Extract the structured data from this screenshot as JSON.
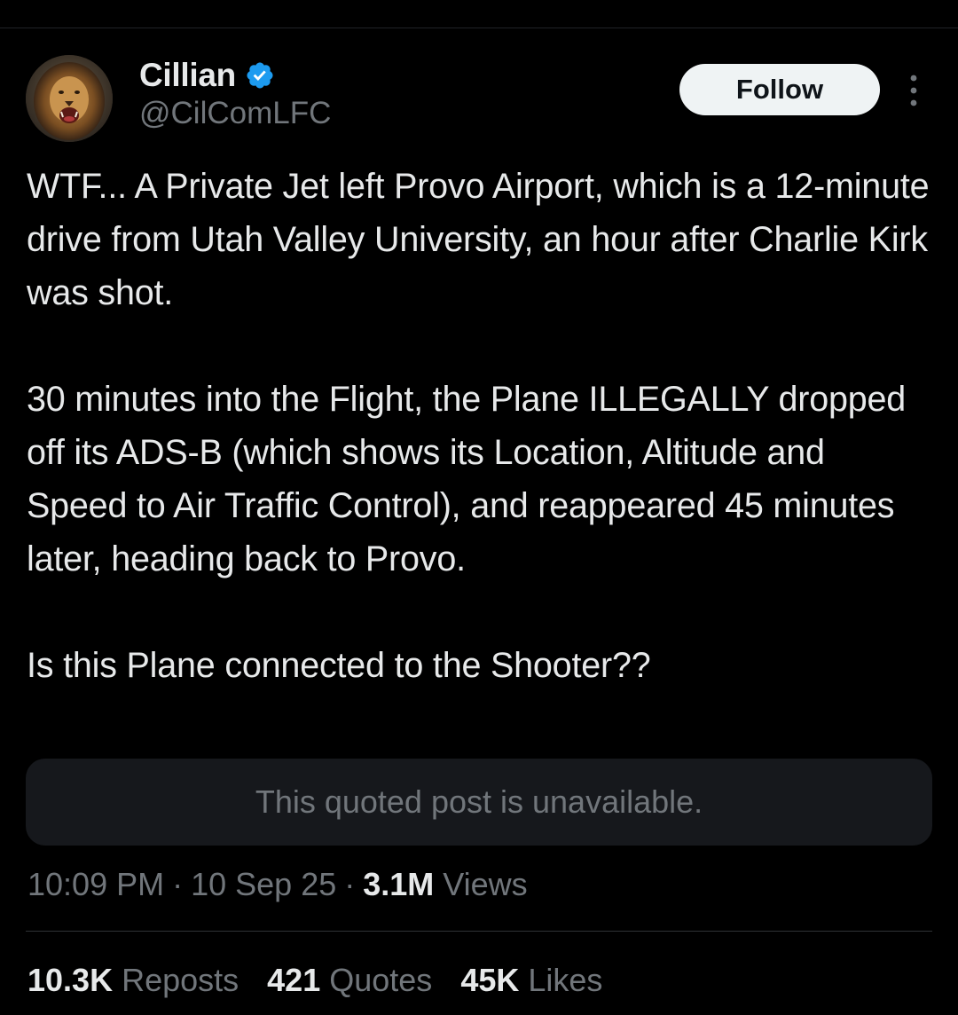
{
  "author": {
    "display_name": "Cillian",
    "handle": "@CilComLFC",
    "verified_icon": "verified-badge-icon",
    "avatar_icon": "lion-avatar"
  },
  "header": {
    "follow_label": "Follow",
    "more_icon": "more-vertical-icon"
  },
  "post": {
    "paragraphs": [
      "WTF... A Private Jet left Provo Airport, which is a 12-minute drive from Utah Valley University, an hour after Charlie Kirk was shot.",
      "30 minutes into the Flight, the Plane ILLEGALLY dropped off its ADS-B (which shows its Location, Altitude and Speed to Air Traffic Control), and reappeared 45 minutes later, heading back to Provo.",
      "Is this Plane connected to the Shooter??"
    ]
  },
  "quoted_post": {
    "text": "This quoted post is unavailable."
  },
  "meta": {
    "time": "10:09 PM",
    "separator": "·",
    "date": "10 Sep 25",
    "views_count": "3.1M",
    "views_label": "Views"
  },
  "stats": {
    "reposts_count": "10.3K",
    "reposts_label": "Reposts",
    "quotes_count": "421",
    "quotes_label": "Quotes",
    "likes_count": "45K",
    "likes_label": "Likes"
  },
  "colors": {
    "background": "#000000",
    "text_primary": "#e7e9ea",
    "text_secondary": "#71767b",
    "verified_blue": "#1d9bf0",
    "follow_button_bg": "#eff3f4",
    "quote_box_bg": "#16181c",
    "divider": "#2f3336"
  }
}
